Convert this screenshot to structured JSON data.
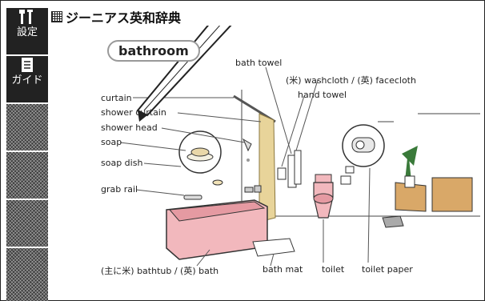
{
  "sidebar": {
    "settings_label": "設定",
    "guide_label": "ガイド"
  },
  "title": "ジーニアス英和辞典",
  "entry_word": "bathroom",
  "labels": {
    "bath_towel": "bath towel",
    "washcloth": "(米) washcloth / (英) facecloth",
    "hand_towel": "hand towel",
    "curtain": "curtain",
    "shower_curtain": "shower curtain",
    "shower_head": "shower head",
    "soap": "soap",
    "soap_dish": "soap dish",
    "grab_rail": "grab rail",
    "bathtub": "(主に米) bathtub / (英) bath",
    "bath_mat": "bath mat",
    "toilet": "toilet",
    "toilet_paper": "toilet paper"
  },
  "colors": {
    "bathtub_fill": "#f2b8bd",
    "curtain_fill": "#e8d49a",
    "toilet_fill": "#f2b8bd",
    "plant": "#3a7a3a"
  },
  "icons": [
    "tools-icon",
    "guide-book-icon",
    "stylus-icon"
  ]
}
